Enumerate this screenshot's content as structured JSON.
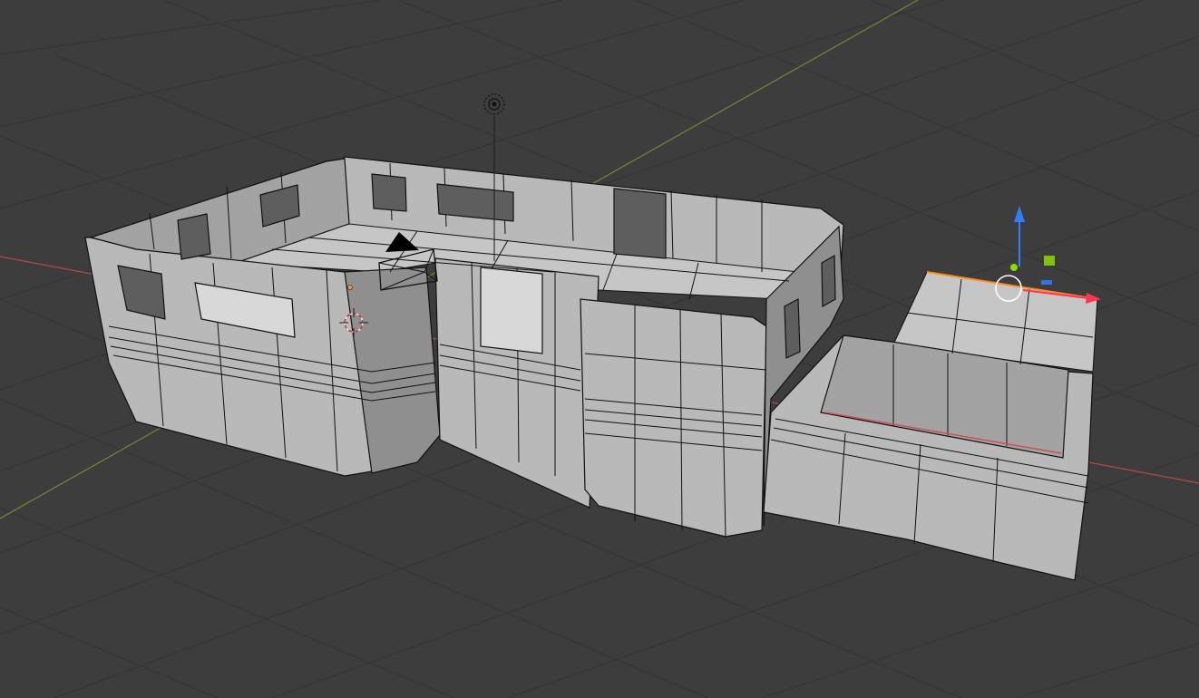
{
  "viewport": {
    "background": "#3d3d3d",
    "grid_color": "#343434",
    "axis_x_color": "#b54a4a",
    "axis_y_color": "#6f8a2e",
    "mesh_color": "#b9b9b9",
    "wire_color": "#111111",
    "selection_color": "#ff8c1a"
  },
  "scene": {
    "objects": [
      {
        "name": "building-mesh",
        "selected": false
      },
      {
        "name": "balcony-mesh",
        "selected": true
      },
      {
        "name": "camera",
        "selected": false
      },
      {
        "name": "light",
        "selected": false
      },
      {
        "name": "3d-cursor",
        "selected": false
      }
    ]
  },
  "gizmo": {
    "x_axis_color": "#ff3352",
    "z_axis_color": "#2f7fff",
    "y_plane_color": "#8bdc00",
    "center_color": "#ffffff"
  }
}
